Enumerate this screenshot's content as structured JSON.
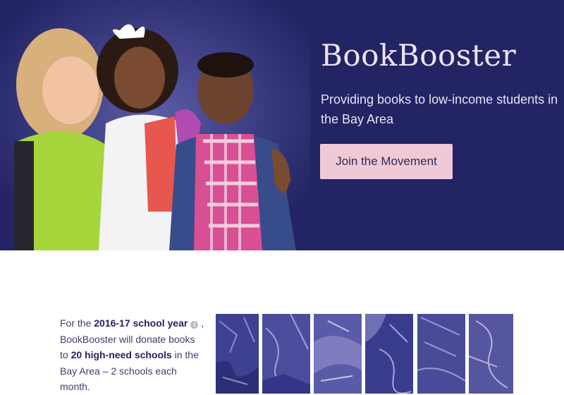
{
  "hero": {
    "brand": "BookBooster",
    "tagline": "Providing books to low-income students in the Bay Area",
    "cta_label": "Join the Movement"
  },
  "info": {
    "text_1": "For the ",
    "school_year": "2016-17 school year",
    "info_icon": "i",
    "text_2": " , BookBooster will donate books to ",
    "schools": "20 high-need schools",
    "text_3": " in the Bay Area – 2 schools each month."
  },
  "colors": {
    "hero_bg": "#232464",
    "cta_bg": "#f0c9d7",
    "tile_tint": "#3d3f8f"
  },
  "icons": [
    "info-icon"
  ]
}
